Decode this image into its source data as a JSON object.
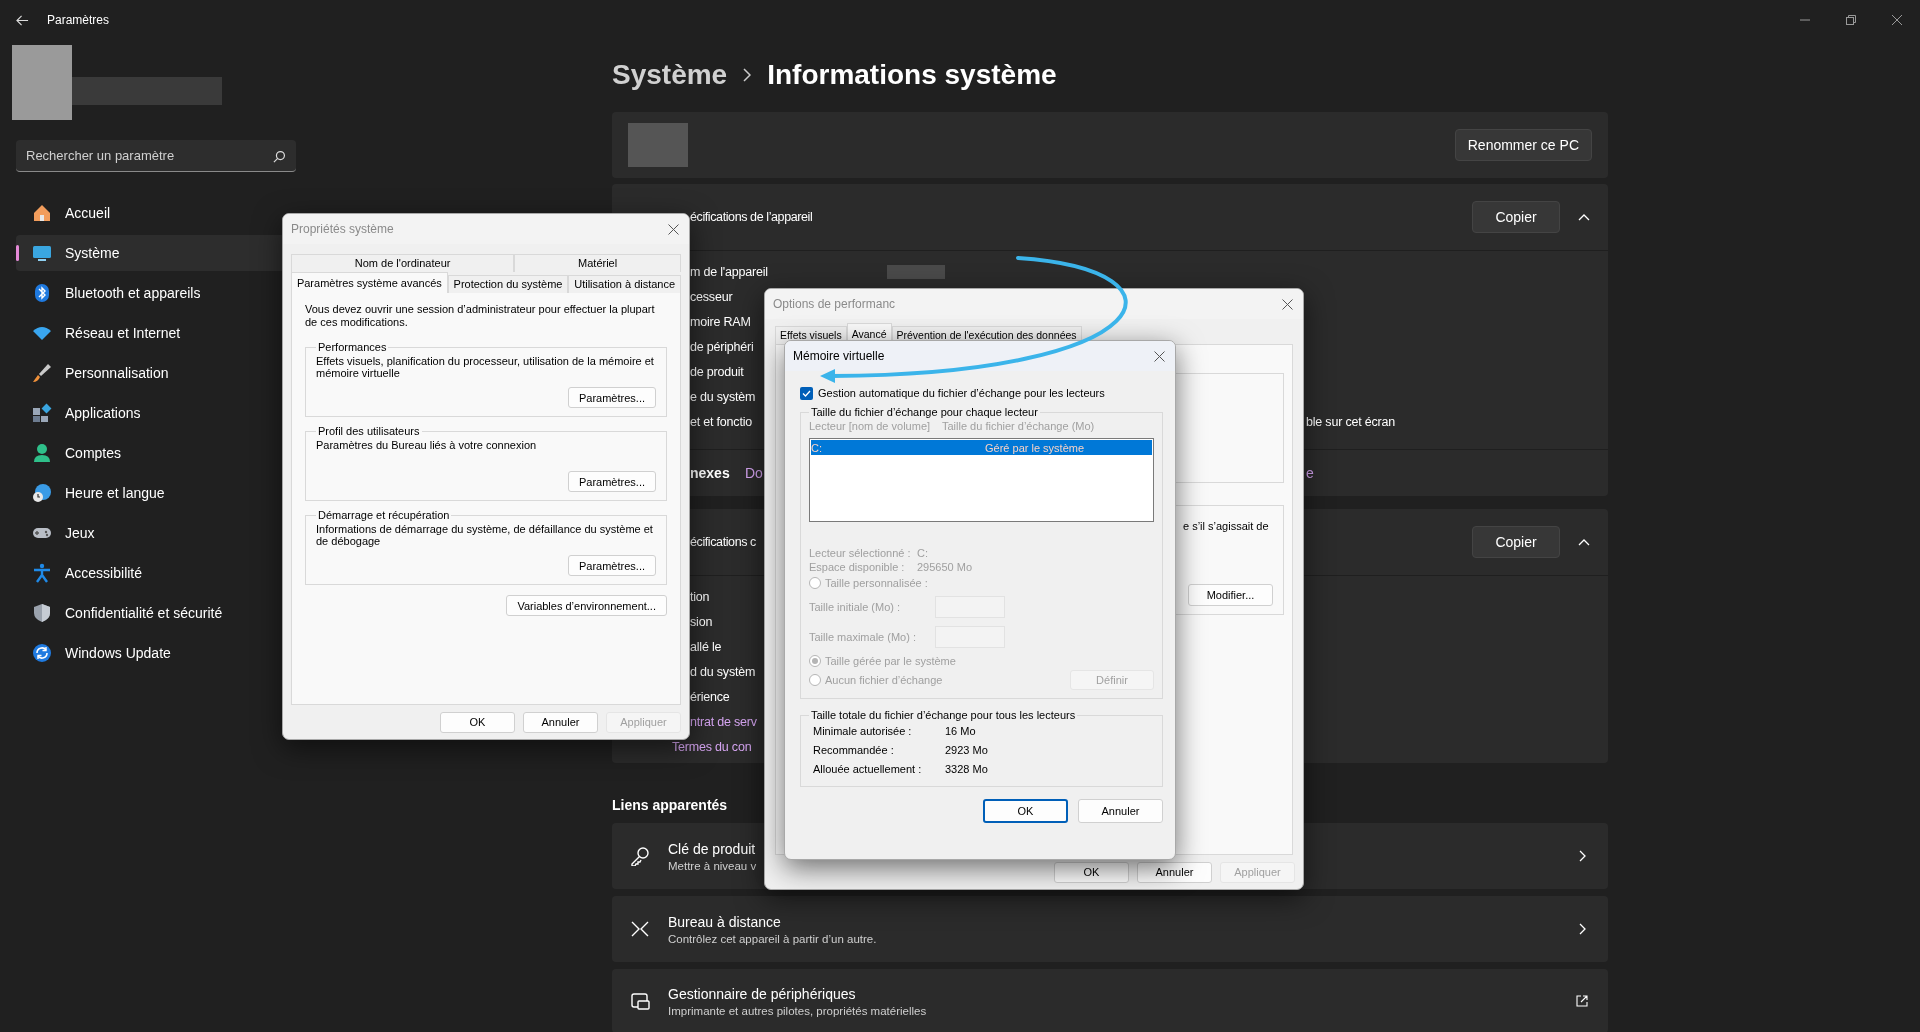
{
  "window": {
    "title": "Paramètres"
  },
  "search": {
    "placeholder": "Rechercher un paramètre"
  },
  "nav": [
    {
      "label": "Accueil",
      "selected": false
    },
    {
      "label": "Système",
      "selected": true
    },
    {
      "label": "Bluetooth et appareils",
      "selected": false
    },
    {
      "label": "Réseau et Internet",
      "selected": false
    },
    {
      "label": "Personnalisation",
      "selected": false
    },
    {
      "label": "Applications",
      "selected": false
    },
    {
      "label": "Comptes",
      "selected": false
    },
    {
      "label": "Heure et langue",
      "selected": false
    },
    {
      "label": "Jeux",
      "selected": false
    },
    {
      "label": "Accessibilité",
      "selected": false
    },
    {
      "label": "Confidentialité et sécurité",
      "selected": false
    },
    {
      "label": "Windows Update",
      "selected": false
    }
  ],
  "breadcrumb": {
    "parent": "Système",
    "current": "Informations système"
  },
  "device_card": {
    "rename_button": "Renommer ce PC"
  },
  "device_specs": {
    "heading": "écifications de l’appareil",
    "copy_button": "Copier",
    "expanded": true,
    "rows": [
      {
        "label": "m de l'appareil",
        "redacted": true
      },
      {
        "label": "cesseur"
      },
      {
        "label": "moire RAM"
      },
      {
        "label": "de périphéri"
      },
      {
        "label": "de produit"
      },
      {
        "label": "e du systèm"
      },
      {
        "label": "et et fonctio",
        "tail": "ble sur cet écran"
      }
    ],
    "links_label": "nexes",
    "link": "Do",
    "link_tail": "e"
  },
  "windows_specs": {
    "heading": "écifications c",
    "copy_button": "Copier",
    "expanded": true,
    "rows": [
      {
        "label": "tion",
        "kind": "text"
      },
      {
        "label": "sion",
        "kind": "text"
      },
      {
        "label": "allé le",
        "kind": "text"
      },
      {
        "label": "d du systèm",
        "kind": "text"
      },
      {
        "label": "érience",
        "kind": "text"
      },
      {
        "label": "ntrat de serv",
        "kind": "link"
      },
      {
        "label": "Termes du con",
        "kind": "link"
      }
    ]
  },
  "related": {
    "heading": "Liens apparentés",
    "items": [
      {
        "title": "Clé de produit",
        "subtitle": "Mettre à niveau v"
      },
      {
        "title": "Bureau à distance",
        "subtitle": "Contrôlez cet appareil à partir d’un autre."
      },
      {
        "title": "Gestionnaire de périphériques",
        "subtitle": "Imprimante et autres pilotes, propriétés matérielles"
      }
    ]
  },
  "system_properties": {
    "title": "Propriétés système",
    "tab_rows": [
      {
        "tabs": [
          {
            "label": "Nom de l'ordinateur",
            "selected": false
          },
          {
            "label": "Matériel",
            "selected": false
          }
        ]
      },
      {
        "tabs": [
          {
            "label": "Paramètres système avancés",
            "selected": true
          },
          {
            "label": "Protection du système",
            "selected": false
          },
          {
            "label": "Utilisation à distance",
            "selected": false
          }
        ]
      }
    ],
    "note": "Vous devez ouvrir une session d’administrateur pour effectuer la plupart de ces modifications.",
    "groups": [
      {
        "title": "Performances",
        "text": "Effets visuels, planification du processeur, utilisation de la mémoire et mémoire virtuelle",
        "button": "Paramètres..."
      },
      {
        "title": "Profil des utilisateurs",
        "text": "Paramètres du Bureau liés à votre connexion",
        "button": "Paramètres..."
      },
      {
        "title": "Démarrage et récupération",
        "text": "Informations de démarrage du système, de défaillance du système et de débogage",
        "button": "Paramètres..."
      }
    ],
    "env_button": "Variables d’environnement...",
    "buttons": [
      {
        "label": "OK",
        "disabled": false
      },
      {
        "label": "Annuler",
        "disabled": false
      },
      {
        "label": "Appliquer",
        "disabled": true
      }
    ]
  },
  "performance_options": {
    "title": "Options de performanc",
    "tabs": [
      {
        "label": "Effets visuels",
        "selected": false
      },
      {
        "label": "Avancé",
        "selected": true
      },
      {
        "label": "Prévention de l'exécution des données",
        "selected": false
      }
    ],
    "group_text": "e s’il s’agissait de",
    "modify_button": "Modifier...",
    "buttons": [
      {
        "label": "OK",
        "disabled": false
      },
      {
        "label": "Annuler",
        "disabled": false
      },
      {
        "label": "Appliquer",
        "disabled": true
      }
    ]
  },
  "virtual_memory": {
    "title": "Mémoire virtuelle",
    "auto_manage": {
      "label": "Gestion automatique du fichier d’échange pour les lecteurs",
      "checked": true
    },
    "per_drive": {
      "title": "Taille du fichier d’échange pour chaque lecteur",
      "disabled": true,
      "columns": [
        "Lecteur [nom de volume]",
        "Taille du fichier d’échange (Mo)"
      ],
      "drives": [
        {
          "drive": "C:",
          "size": "Géré par le système",
          "selected": true
        }
      ],
      "details": [
        {
          "label": "Lecteur sélectionné :",
          "value": "C:"
        },
        {
          "label": "Espace disponible :",
          "value": "295650 Mo"
        }
      ],
      "custom_radio": {
        "label": "Taille personnalisée :",
        "selected": false
      },
      "fields": [
        {
          "label": "Taille initiale (Mo) :"
        },
        {
          "label": "Taille maximale (Mo) :"
        }
      ],
      "system_radio": {
        "label": "Taille gérée par le système",
        "selected": true
      },
      "none_radio": {
        "label": "Aucun fichier d’échange",
        "selected": false
      },
      "set_button": "Définir"
    },
    "totals": {
      "title": "Taille totale du fichier d’échange pour tous les lecteurs",
      "rows": [
        {
          "label": "Minimale autorisée :",
          "value": "16 Mo"
        },
        {
          "label": "Recommandée :",
          "value": "2923 Mo"
        },
        {
          "label": "Allouée actuellement :",
          "value": "3328 Mo"
        }
      ]
    },
    "buttons": [
      {
        "label": "OK",
        "default": true
      },
      {
        "label": "Annuler",
        "default": false
      }
    ]
  }
}
